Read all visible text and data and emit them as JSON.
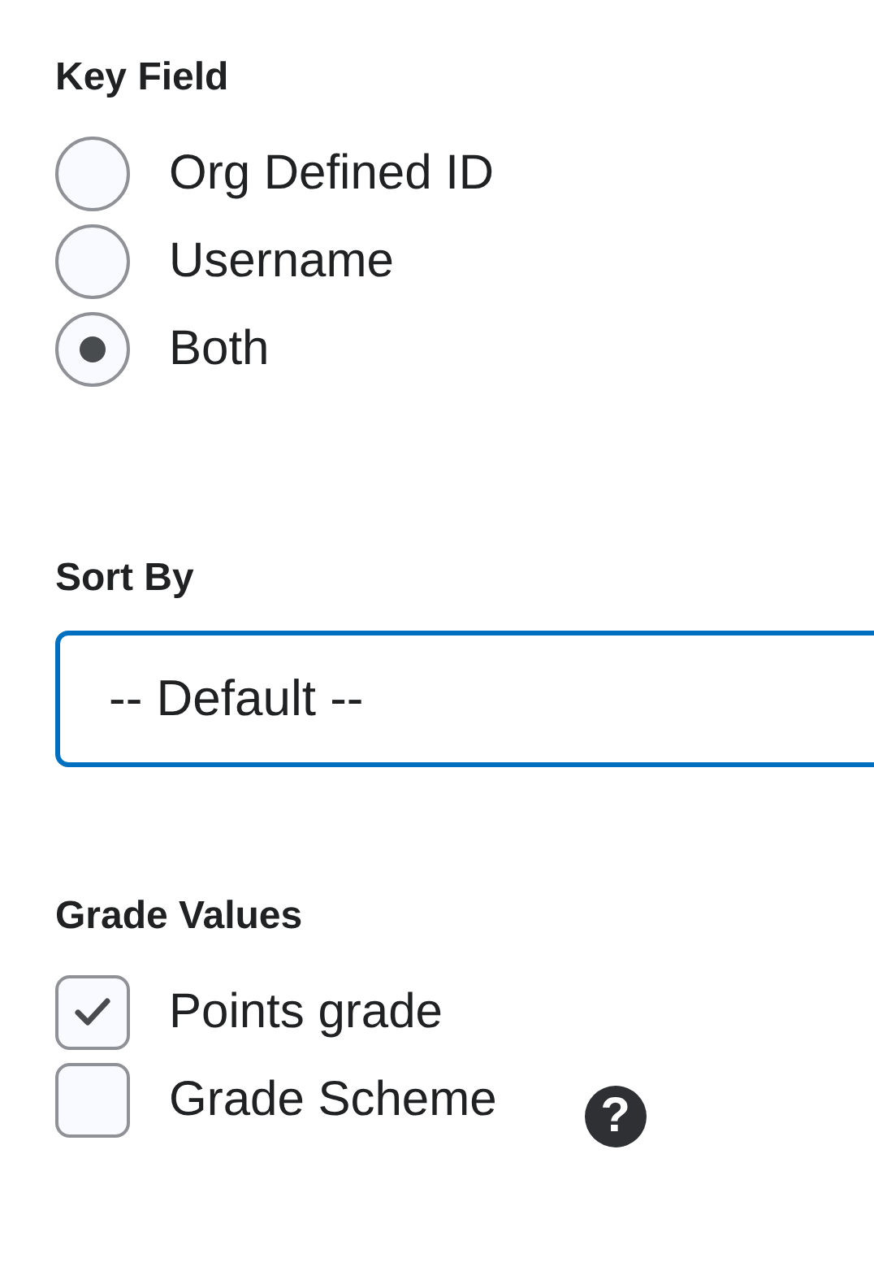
{
  "key_field": {
    "label": "Key Field",
    "options": [
      {
        "label": "Org Defined ID",
        "selected": false
      },
      {
        "label": "Username",
        "selected": false
      },
      {
        "label": "Both",
        "selected": true
      }
    ]
  },
  "sort_by": {
    "label": "Sort By",
    "value": "-- Default --"
  },
  "grade_values": {
    "label": "Grade Values",
    "options": [
      {
        "label": "Points grade",
        "checked": true
      },
      {
        "label": "Grade Scheme",
        "checked": false,
        "help": "?"
      }
    ]
  }
}
